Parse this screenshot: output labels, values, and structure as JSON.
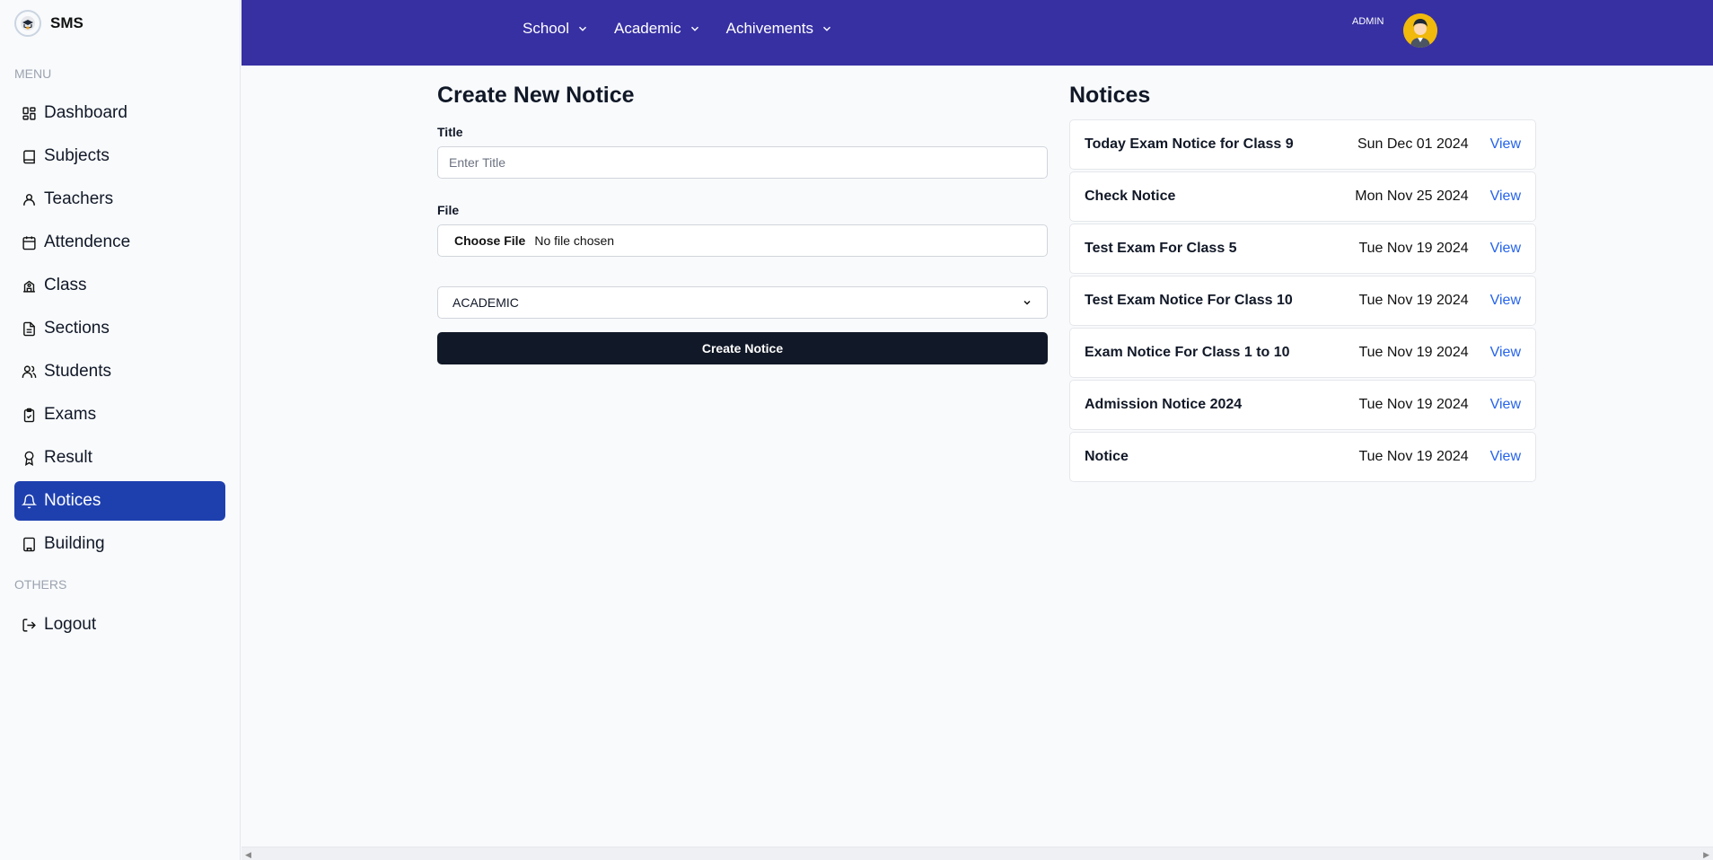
{
  "brand": {
    "name": "SMS"
  },
  "sidebar": {
    "menu_heading": "MENU",
    "others_heading": "OTHERS",
    "items": [
      {
        "label": "Dashboard",
        "icon": "dashboard-icon"
      },
      {
        "label": "Subjects",
        "icon": "book-icon"
      },
      {
        "label": "Teachers",
        "icon": "user-icon"
      },
      {
        "label": "Attendence",
        "icon": "calendar-icon"
      },
      {
        "label": "Class",
        "icon": "school-icon"
      },
      {
        "label": "Sections",
        "icon": "document-icon"
      },
      {
        "label": "Students",
        "icon": "users-icon"
      },
      {
        "label": "Exams",
        "icon": "clipboard-icon"
      },
      {
        "label": "Result",
        "icon": "award-icon"
      },
      {
        "label": "Notices",
        "icon": "bell-icon",
        "active": true
      },
      {
        "label": "Building",
        "icon": "building-icon"
      }
    ],
    "others": [
      {
        "label": "Logout",
        "icon": "logout-icon"
      }
    ]
  },
  "topbar": {
    "nav": [
      {
        "label": "School"
      },
      {
        "label": "Academic"
      },
      {
        "label": "Achivements"
      }
    ],
    "user_role": "ADMIN"
  },
  "form": {
    "title": "Create New Notice",
    "title_label": "Title",
    "title_placeholder": "Enter Title",
    "file_label": "File",
    "file_button": "Choose File",
    "file_status": "No file chosen",
    "category_selected": "ACADEMIC",
    "submit_label": "Create Notice"
  },
  "notices": {
    "title": "Notices",
    "view_label": "View",
    "items": [
      {
        "title": "Today Exam Notice for Class 9",
        "date": "Sun Dec 01 2024"
      },
      {
        "title": "Check Notice",
        "date": "Mon Nov 25 2024"
      },
      {
        "title": "Test Exam For Class 5",
        "date": "Tue Nov 19 2024"
      },
      {
        "title": "Test Exam Notice For Class 10",
        "date": "Tue Nov 19 2024"
      },
      {
        "title": "Exam Notice For Class 1 to 10",
        "date": "Tue Nov 19 2024"
      },
      {
        "title": "Admission Notice 2024",
        "date": "Tue Nov 19 2024"
      },
      {
        "title": "Notice",
        "date": "Tue Nov 19 2024"
      }
    ]
  },
  "colors": {
    "topbar": "#3730a3",
    "active_nav": "#1e40af",
    "primary_button": "#111827",
    "link": "#2563eb"
  }
}
